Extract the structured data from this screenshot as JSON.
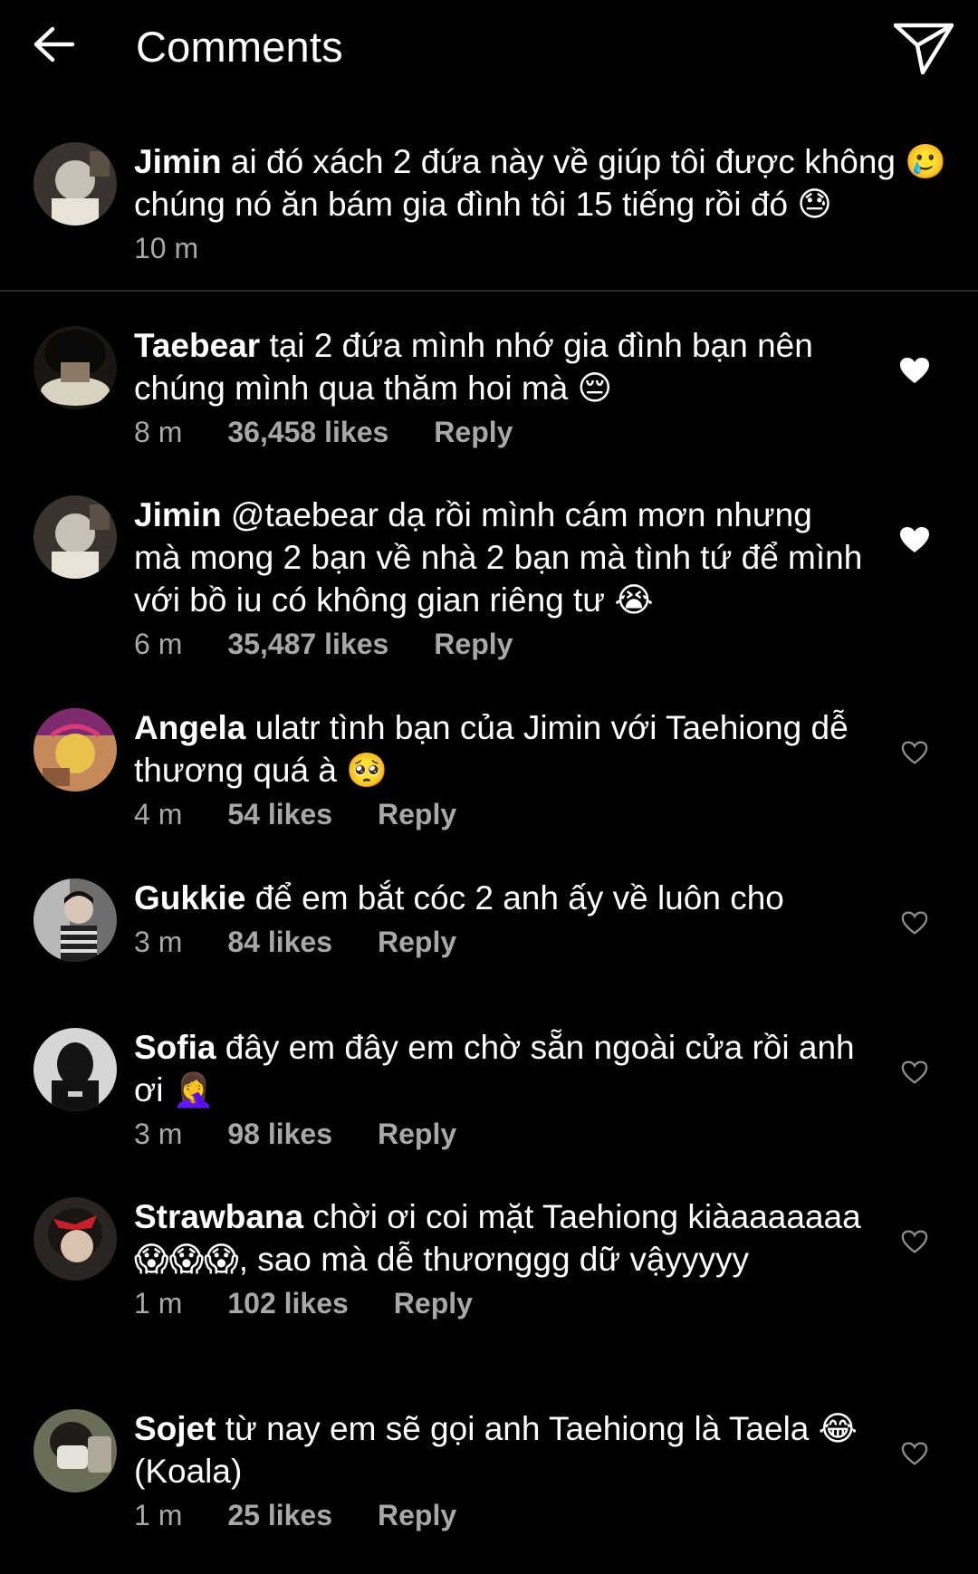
{
  "header": {
    "title": "Comments",
    "back_icon": "arrow-left-icon",
    "send_icon": "paper-plane-icon"
  },
  "caption": {
    "username": "Jimin",
    "text": " ai đó xách 2 đứa này về giúp tôi được không 🥲 chúng nó ăn bám gia đình tôi 15 tiếng rồi đó 😓",
    "time": "10 m"
  },
  "comments": [
    {
      "username": "Taebear",
      "text": " tại 2 đứa mình nhớ gia đình bạn nên chúng mình qua thăm hoi mà 😔",
      "time": "8 m",
      "likes": "36,458 likes",
      "reply": "Reply",
      "liked": true
    },
    {
      "username": "Jimin",
      "text": " @taebear dạ rồi mình cám mơn nhưng mà mong 2 bạn về nhà 2 bạn mà tình tứ để mình với bồ iu có không gian riêng tư 😭",
      "time": "6 m",
      "likes": "35,487 likes",
      "reply": "Reply",
      "liked": true
    },
    {
      "username": "Angela",
      "text": " ulatr tình bạn của Jimin với Taehiong dễ thương quá à 🥺",
      "time": "4 m",
      "likes": "54 likes",
      "reply": "Reply",
      "liked": false
    },
    {
      "username": "Gukkie",
      "text": " để em bắt cóc 2 anh ấy về luôn cho",
      "time": "3 m",
      "likes": "84 likes",
      "reply": "Reply",
      "liked": false
    },
    {
      "username": "Sofia",
      "text": " đây em đây em chờ sẵn ngoài cửa rồi anh ơi 🤦‍♀️",
      "time": "3 m",
      "likes": "98 likes",
      "reply": "Reply",
      "liked": false
    },
    {
      "username": "Strawbana",
      "text": " chời ơi coi mặt Taehiong kiàaaaaaaa 😱😱😱, sao mà dễ thươnggg dữ vậyyyyy",
      "time": "1 m",
      "likes": "102 likes",
      "reply": "Reply",
      "liked": false
    },
    {
      "username": "Sojet",
      "text": " từ nay em sẽ gọi anh Taehiong là Taela 😂 (Koala)",
      "time": "1 m",
      "likes": "25 likes",
      "reply": "Reply",
      "liked": false
    }
  ],
  "colors": {
    "background": "#000000",
    "text": "#ffffff",
    "meta": "#a8a8a8",
    "divider": "#2a2a2a"
  }
}
